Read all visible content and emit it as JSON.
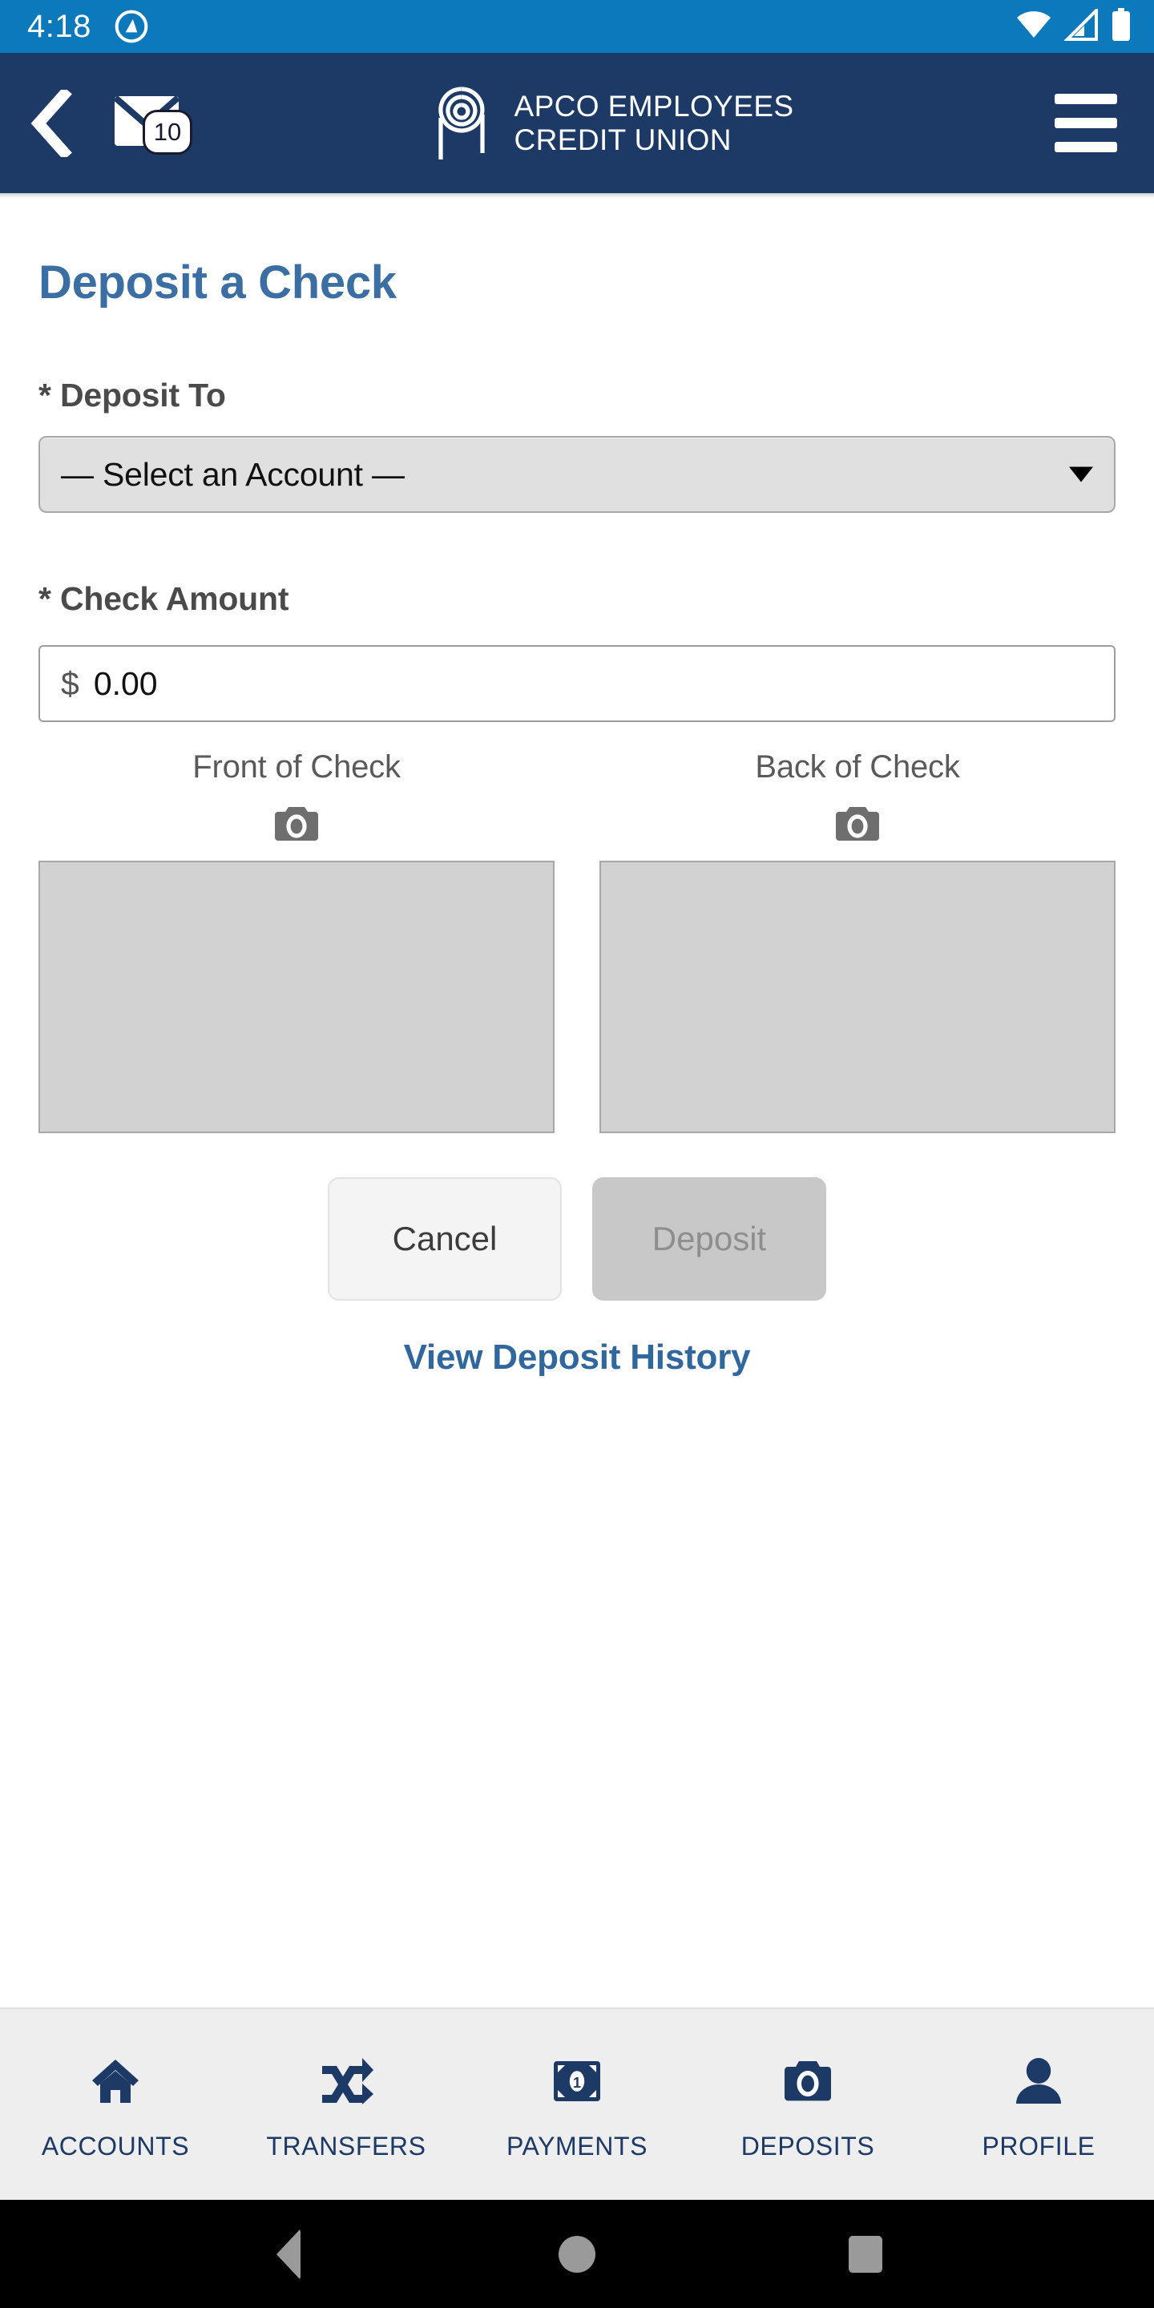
{
  "status_bar": {
    "time": "4:18",
    "app_icon": "circle-logo-icon",
    "wifi_icon": "wifi-icon",
    "signal_icon": "cell-signal-icon",
    "battery_icon": "battery-full-icon",
    "background_color": "#0b79bc"
  },
  "header": {
    "background_color": "#1d3a66",
    "back_icon": "chevron-left-icon",
    "mail_icon": "envelope-icon",
    "mail_badge_count": "10",
    "logo_icon": "apco-spiral-logo-icon",
    "brand_line1": "APCO EMPLOYEES",
    "brand_line2": "CREDIT UNION",
    "menu_icon": "hamburger-menu-icon"
  },
  "main": {
    "page_title": "Deposit a Check",
    "title_color": "#3b6fa4",
    "deposit_to": {
      "label": "* Deposit To",
      "selected_option": "— Select an Account —",
      "arrow_icon": "chevron-down-icon"
    },
    "check_amount": {
      "label": "* Check Amount",
      "currency_symbol": "$",
      "value": "0.00",
      "placeholder": "0.00"
    },
    "captures": [
      {
        "caption": "Front of Check",
        "camera_icon": "camera-icon",
        "image_value": ""
      },
      {
        "caption": "Back of Check",
        "camera_icon": "camera-icon",
        "image_value": ""
      }
    ],
    "buttons": {
      "cancel_label": "Cancel",
      "deposit_label": "Deposit",
      "deposit_disabled": true
    },
    "history_link": "View Deposit History",
    "link_color": "#31679f"
  },
  "bottom_nav": {
    "accent_color": "#1d3a66",
    "items": [
      {
        "label": "ACCOUNTS",
        "icon": "home-icon"
      },
      {
        "label": "TRANSFERS",
        "icon": "shuffle-arrows-icon"
      },
      {
        "label": "PAYMENTS",
        "icon": "money-bill-icon"
      },
      {
        "label": "DEPOSITS",
        "icon": "camera-icon"
      },
      {
        "label": "PROFILE",
        "icon": "person-icon"
      }
    ]
  },
  "system_nav": {
    "back_icon": "android-back-icon",
    "home_icon": "android-home-icon",
    "recents_icon": "android-recents-icon"
  }
}
